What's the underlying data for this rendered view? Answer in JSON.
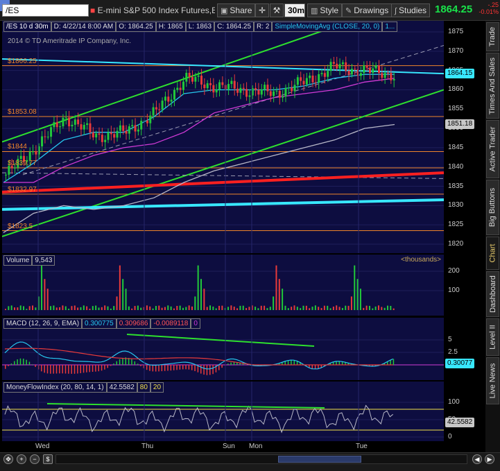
{
  "toolbar": {
    "symbol": "/ES",
    "instrument_name": "E-mini S&P 500 Index Futures,ET...",
    "share_label": "Share",
    "aggregation_label": "30m",
    "style_label": "Style",
    "drawings_label": "Drawings",
    "studies_label": "Studies",
    "last_price": "1864.25",
    "net_change": "-.25",
    "pct_change": "-0.01%"
  },
  "header": {
    "symbol_period": "/ES 10 d 30m",
    "date": "D: 4/22/14 8:00 AM",
    "open": "O: 1864.25",
    "high": "H: 1865",
    "low": "L: 1863",
    "close": "C: 1864.25",
    "range": "R: 2",
    "study": "SimpleMovingAvg (CLOSE, 20, 0)",
    "more": "1...",
    "copyright": "2014 © TD Ameritrade IP Company, Inc."
  },
  "side_tabs": [
    {
      "label": "Trade"
    },
    {
      "label": "Times And Sales"
    },
    {
      "label": "Active Trader"
    },
    {
      "label": "Big Buttons"
    },
    {
      "label": "Chart"
    },
    {
      "label": "Dashboard"
    },
    {
      "label": "Level II"
    },
    {
      "label": "Live News"
    }
  ],
  "price_axis": {
    "ticks": [
      "1875",
      "1870",
      "1865",
      "1860",
      "1855",
      "1850",
      "1845",
      "1840",
      "1835",
      "1830",
      "1825",
      "1820"
    ],
    "tag_current": "1864.15",
    "tag_sma": "1851.18"
  },
  "level_labels": [
    "$1866.25",
    "$1853.08",
    "$1844",
    "$1839.77",
    "$1832.97",
    "$1823.5"
  ],
  "volume": {
    "title": "Volume",
    "value": "9,543",
    "unit": "<thousands>",
    "ticks": [
      "200",
      "100"
    ]
  },
  "macd": {
    "title": "MACD (12, 26, 9, EMA)",
    "value": "0.300775",
    "avg": "0.309686",
    "diff": "-0.0089118",
    "zero": "0",
    "ticks": [
      "5",
      "2.5"
    ],
    "tag": "0.30077"
  },
  "mfi": {
    "title": "MoneyFlowIndex (20, 80, 14, 1)",
    "value": "42.5582",
    "over": "80",
    "under": "20",
    "ticks": [
      "100",
      "50",
      "0"
    ],
    "tag": "42.5582"
  },
  "time_axis": [
    "Wed",
    "Thu",
    "Sun",
    "Mon",
    "Tue"
  ],
  "colors": {
    "bg": "#0d0d40",
    "up": "#21c93a",
    "down": "#e83a3a",
    "sma_fast": "#27c7ee",
    "sma_mid": "#d13ad6",
    "sma_slow": "#b8b8c8",
    "level": "#f0852a",
    "channel": "#2ee02e",
    "cyan_line": "#38e8ff",
    "red_line": "#ff2020"
  },
  "chart_data": {
    "type": "line",
    "ylim": [
      1818,
      1877
    ],
    "level_lines": [
      1866.25,
      1853.08,
      1844,
      1839.77,
      1832.97,
      1823.5
    ],
    "x": [
      "Wed",
      "Thu",
      "Sun",
      "Mon",
      "Tue"
    ],
    "series": [
      {
        "values": [
          1838,
          1845,
          1853,
          1848,
          1849,
          1854,
          1863,
          1861,
          1860,
          1859,
          1862,
          1866,
          1865,
          1864
        ]
      },
      {
        "values": [
          1836,
          1841,
          1847,
          1849,
          1849,
          1853,
          1859,
          1860,
          1860,
          1860,
          1861,
          1863,
          1864,
          1864
        ]
      },
      {
        "values": [
          1836,
          1836,
          1840,
          1843,
          1845,
          1846,
          1849,
          1854,
          1856,
          1858,
          1859,
          1860,
          1862,
          1863
        ]
      },
      {
        "values": [
          1823,
          1828,
          1830,
          1829,
          1830,
          1832,
          1836,
          1839,
          1841,
          1843,
          1845,
          1847,
          1850,
          1851
        ]
      }
    ]
  }
}
